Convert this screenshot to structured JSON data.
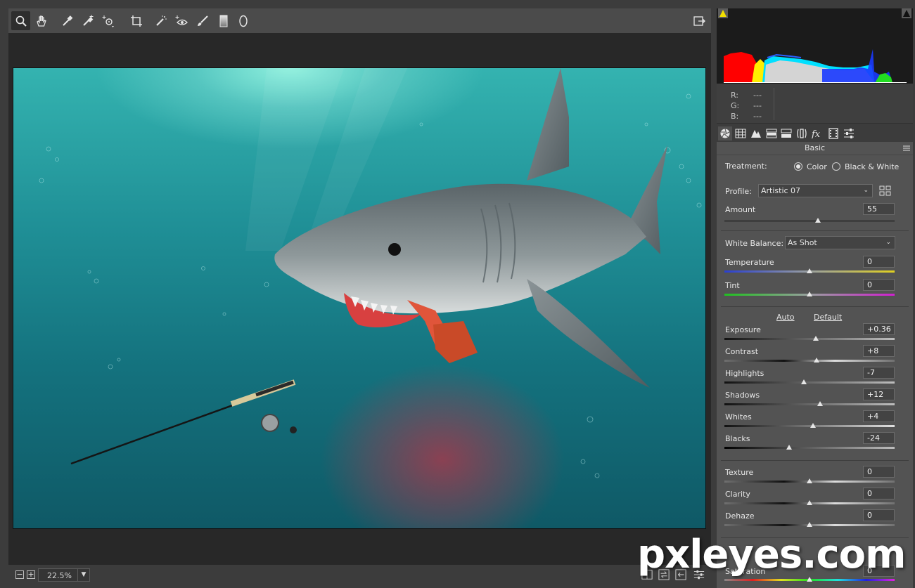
{
  "toolbar": {
    "tools": [
      "zoom-icon",
      "hand-icon",
      "white-balance-icon",
      "color-sampler-icon",
      "targeted-adjustment-icon",
      "crop-icon",
      "spot-removal-icon",
      "red-eye-icon",
      "adjustment-brush-icon",
      "graduated-filter-icon",
      "radial-filter-icon"
    ]
  },
  "histogram": {
    "readout": {
      "r_label": "R:",
      "r_value": "---",
      "g_label": "G:",
      "g_value": "---",
      "b_label": "B:",
      "b_value": "---"
    }
  },
  "panel": {
    "title": "Basic",
    "treatment": {
      "label": "Treatment:",
      "color": "Color",
      "bw": "Black & White",
      "selected": "Color"
    },
    "profile": {
      "label": "Profile:",
      "value": "Artistic 07"
    },
    "amount": {
      "label": "Amount",
      "value": "55",
      "level": 0.55
    },
    "white_balance": {
      "label": "White Balance:",
      "value": "As Shot"
    },
    "temperature": {
      "label": "Temperature",
      "value": "0",
      "level": 0.5
    },
    "tint": {
      "label": "Tint",
      "value": "0",
      "level": 0.5
    },
    "auto": "Auto",
    "default": "Default",
    "exposure": {
      "label": "Exposure",
      "value": "+0.36",
      "level": 0.536
    },
    "contrast": {
      "label": "Contrast",
      "value": "+8",
      "level": 0.54
    },
    "highlights": {
      "label": "Highlights",
      "value": "-7",
      "level": 0.465
    },
    "shadows": {
      "label": "Shadows",
      "value": "+12",
      "level": 0.56
    },
    "whites": {
      "label": "Whites",
      "value": "+4",
      "level": 0.52
    },
    "blacks": {
      "label": "Blacks",
      "value": "-24",
      "level": 0.38
    },
    "texture": {
      "label": "Texture",
      "value": "0",
      "level": 0.5
    },
    "clarity": {
      "label": "Clarity",
      "value": "0",
      "level": 0.5
    },
    "dehaze": {
      "label": "Dehaze",
      "value": "0",
      "level": 0.5
    },
    "saturation": {
      "label": "Saturation",
      "value": "0",
      "level": 0.5
    }
  },
  "statusbar": {
    "zoom": "22.5%"
  },
  "watermark": "pxleyes.com",
  "colors": {
    "panel_bg": "#535353",
    "canvas_bg": "#282828"
  }
}
